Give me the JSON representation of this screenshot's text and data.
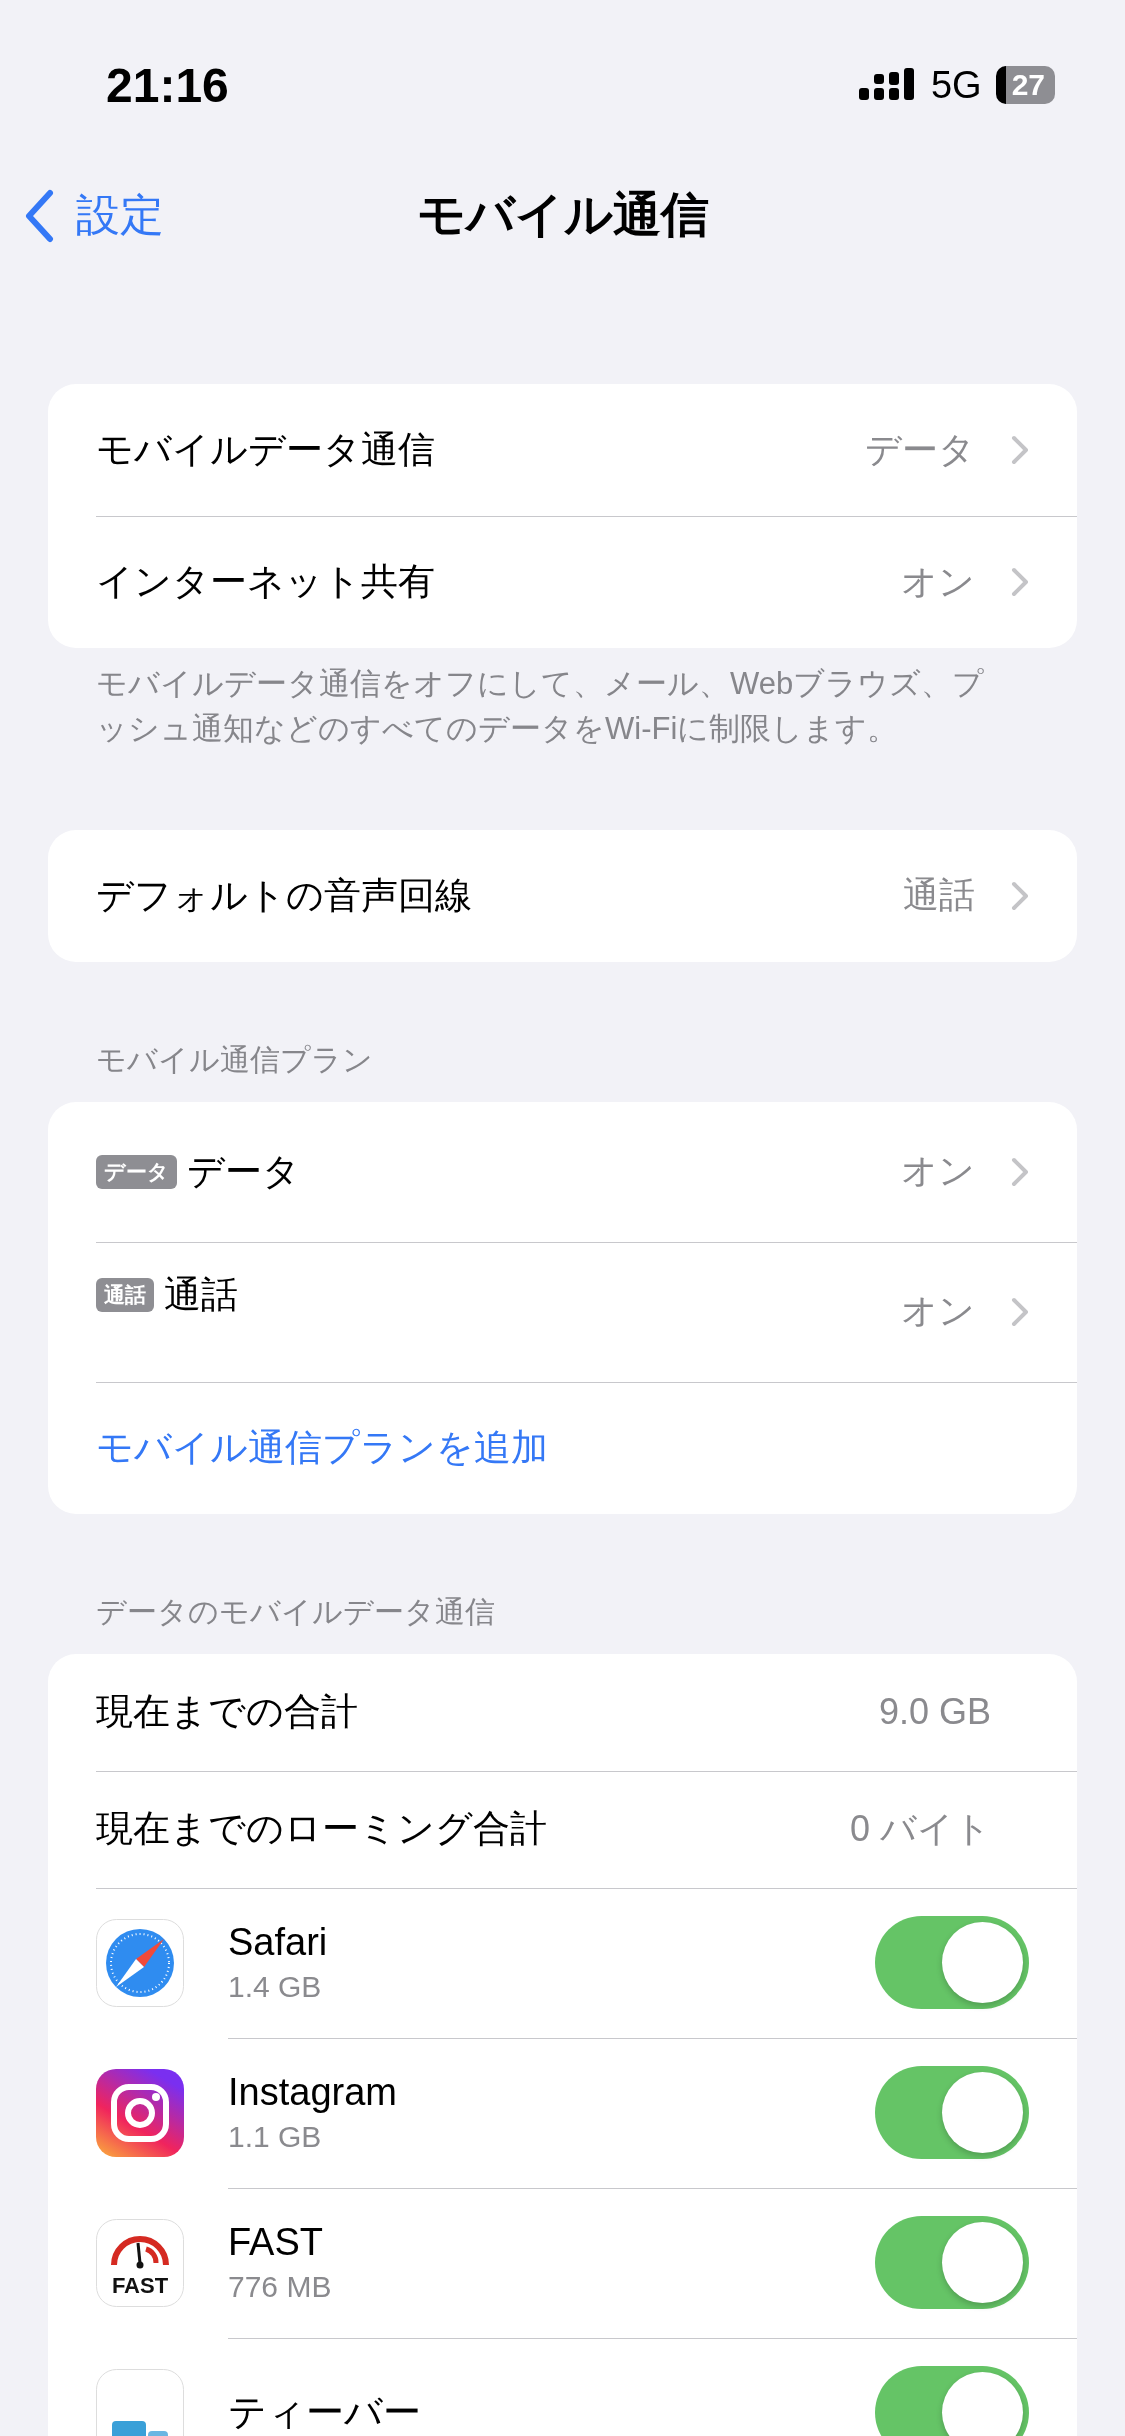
{
  "status_bar": {
    "time": "21:16",
    "network": "5G",
    "battery": "27"
  },
  "nav": {
    "back": "設定",
    "title": "モバイル通信"
  },
  "sections": [
    {
      "rows": [
        {
          "kind": "nav",
          "label": "モバイルデータ通信",
          "value": "データ"
        },
        {
          "kind": "nav",
          "label": "インターネット共有",
          "value": "オン"
        }
      ],
      "footer": "モバイルデータ通信をオフにして、メール、Webブラウズ、プッシュ通知などのすべてのデータをWi-Fiに制限します。"
    },
    {
      "rows": [
        {
          "kind": "nav",
          "label": "デフォルトの音声回線",
          "value": "通話"
        }
      ]
    },
    {
      "header": "モバイル通信プラン",
      "rows": [
        {
          "kind": "plan",
          "tag": "データ",
          "label": "データ",
          "value": "オン"
        },
        {
          "kind": "plan",
          "tag": "通話",
          "label": "通話",
          "value": "オン"
        },
        {
          "kind": "link",
          "label": "モバイル通信プランを追加"
        }
      ]
    },
    {
      "header": "データのモバイルデータ通信",
      "rows": [
        {
          "kind": "stat",
          "label": "現在までの合計",
          "value": "9.0 GB"
        },
        {
          "kind": "stat",
          "label": "現在までのローミング合計",
          "value": "0 バイト"
        },
        {
          "kind": "app",
          "name": "Safari",
          "usage": "1.4 GB",
          "on": true
        },
        {
          "kind": "app",
          "name": "Instagram",
          "usage": "1.1 GB",
          "on": true
        },
        {
          "kind": "app",
          "icon_text": "FAST",
          "name": "FAST",
          "usage": "776 MB",
          "on": true
        },
        {
          "kind": "app",
          "name": "ティーバー",
          "on": true
        }
      ]
    }
  ]
}
